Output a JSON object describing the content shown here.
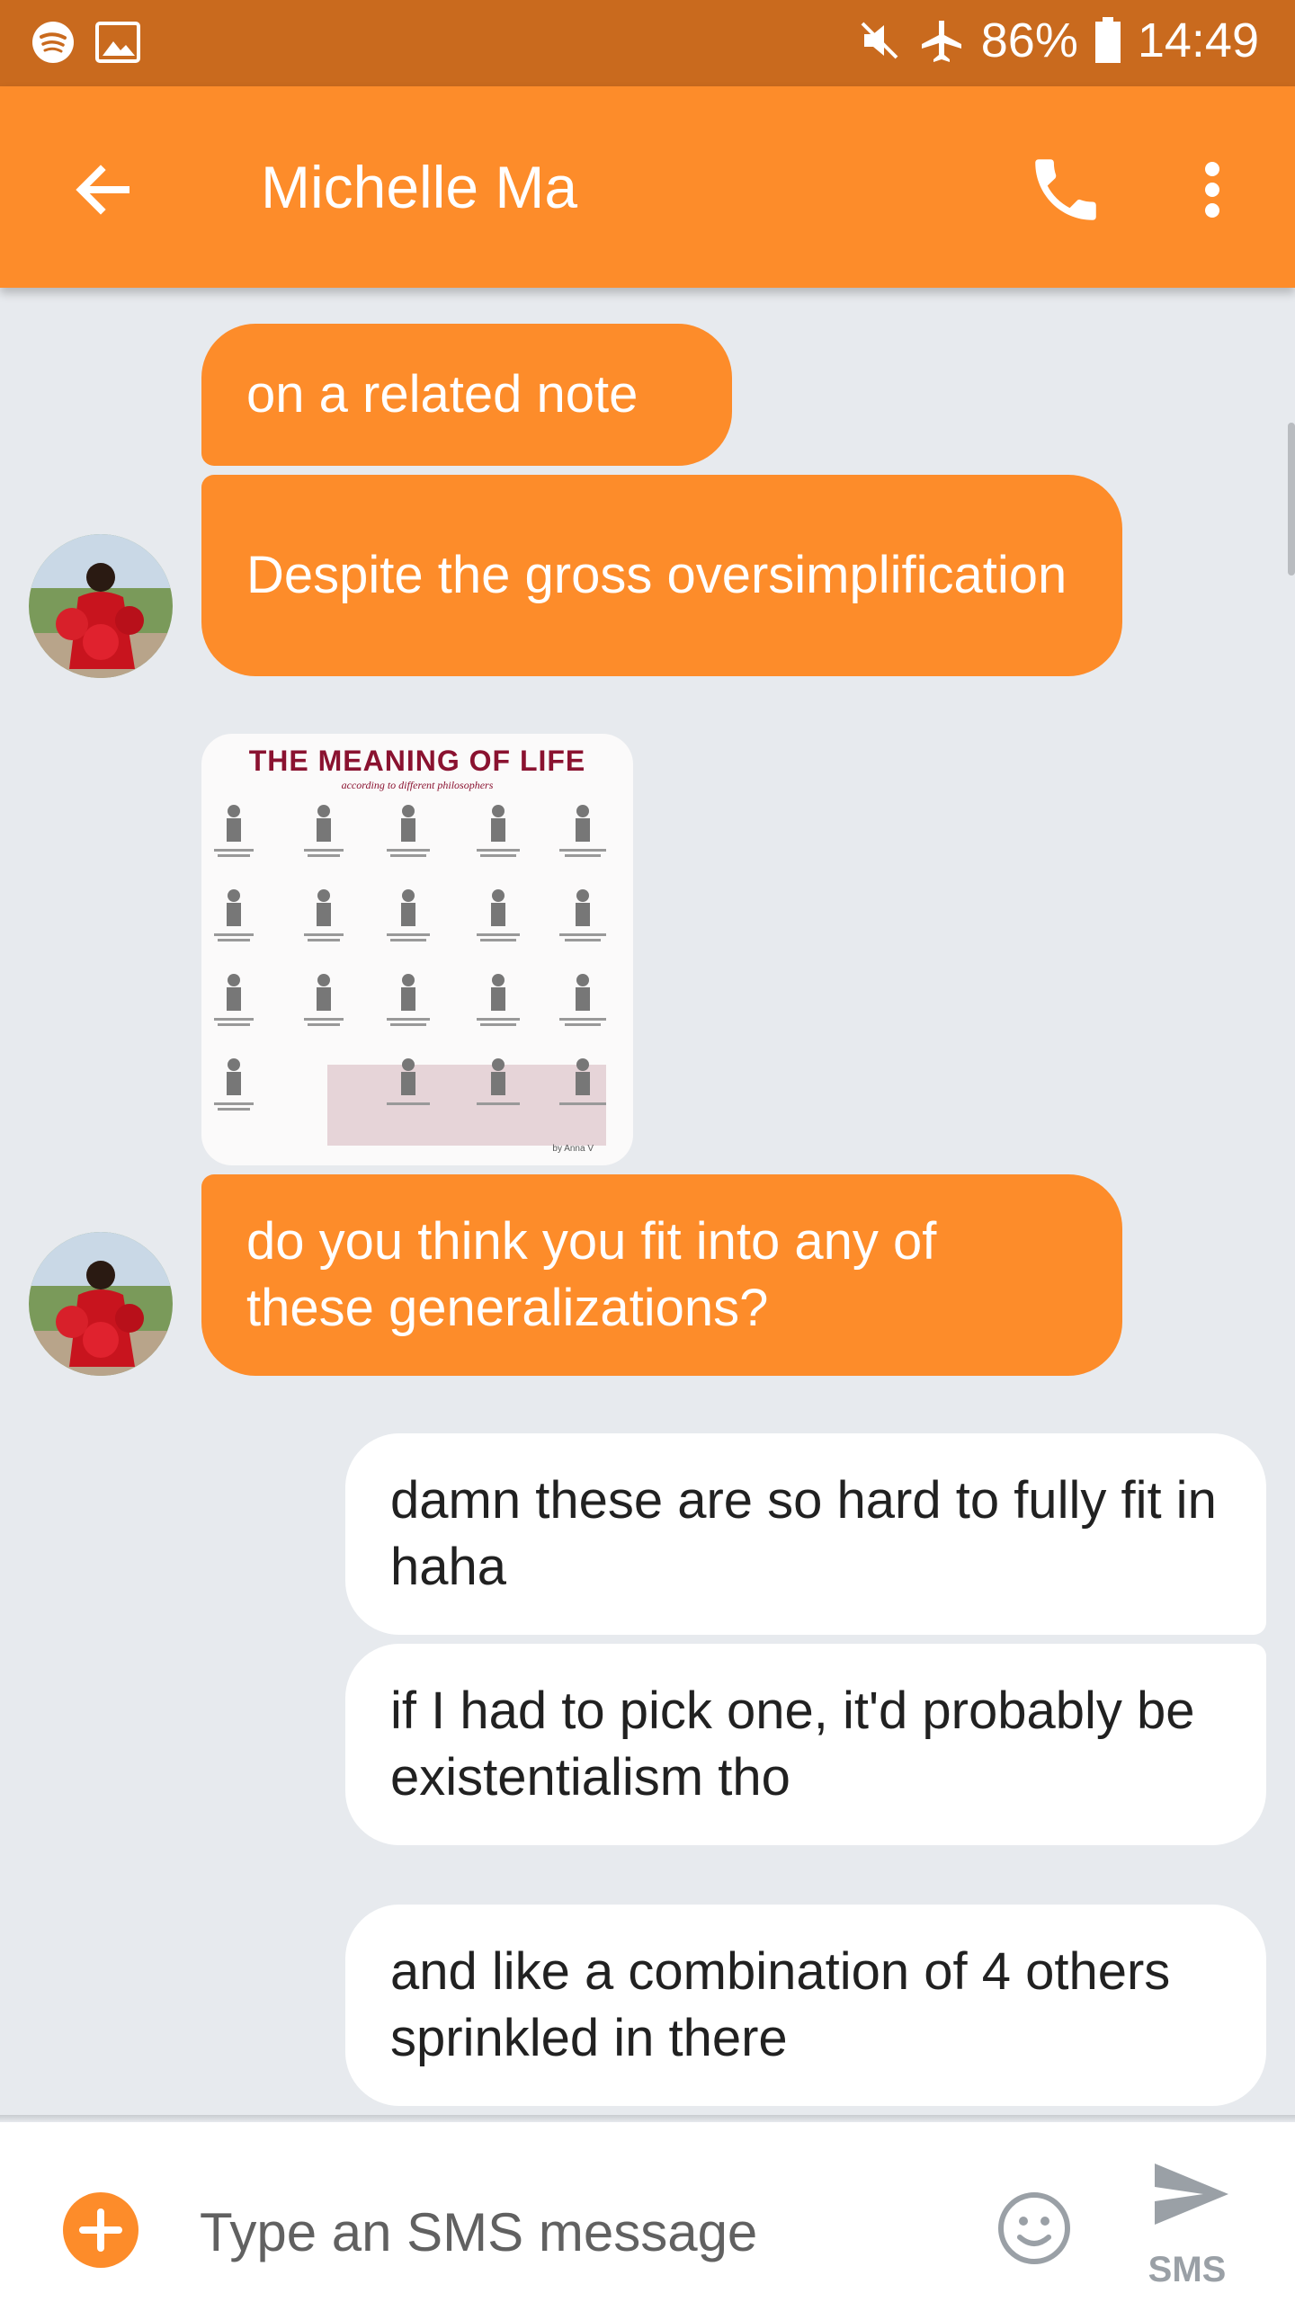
{
  "status_bar": {
    "battery": "86%",
    "time": "14:49",
    "icons": [
      "spotify-icon",
      "image-icon",
      "mute-icon",
      "airplane-icon",
      "battery-icon"
    ]
  },
  "header": {
    "title": "Michelle Ma",
    "icons": [
      "back-arrow-icon",
      "phone-icon",
      "more-vert-icon"
    ]
  },
  "messages": [
    {
      "direction": "incoming",
      "text": "on a related note"
    },
    {
      "direction": "incoming",
      "text": "Despite the gross oversimplification"
    },
    {
      "direction": "incoming",
      "type": "image",
      "image": {
        "title": "THE MEANING OF LIFE",
        "subtitle": "according to different philosophers",
        "author": "by Anna V"
      }
    },
    {
      "direction": "incoming",
      "text": "do you think you fit into any of these generalizations?"
    },
    {
      "direction": "outgoing",
      "text": "damn these are so hard to fully fit in haha"
    },
    {
      "direction": "outgoing",
      "text": "if I had to pick one, it'd probably be existentialism tho"
    },
    {
      "direction": "outgoing",
      "text": "and like a combination of 4 others sprinkled in there"
    }
  ],
  "composer": {
    "placeholder": "Type an SMS message",
    "send_label": "SMS"
  },
  "colors": {
    "status_bar": "#c96a1e",
    "accent": "#fd8c2a",
    "background": "#e7eaee",
    "outgoing_bubble": "#ffffff"
  }
}
